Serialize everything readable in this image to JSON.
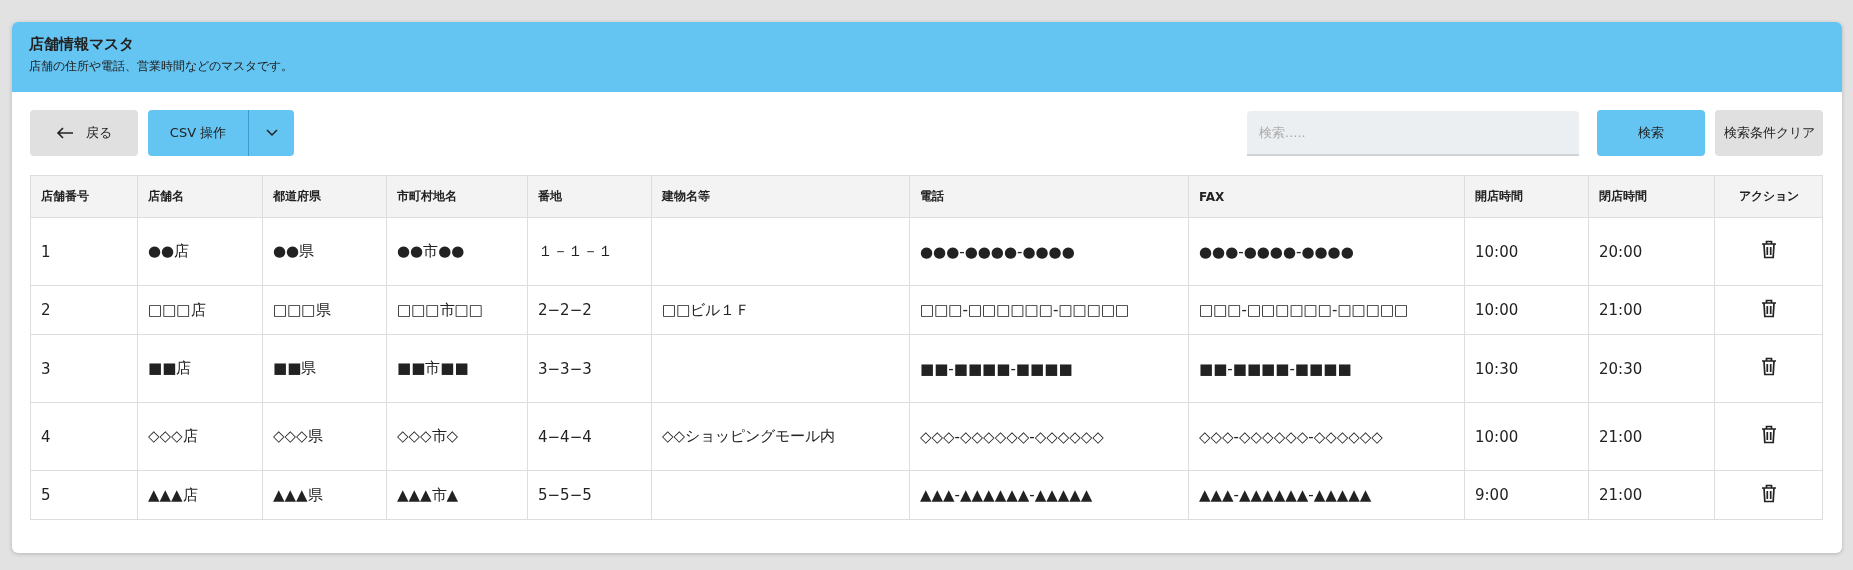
{
  "header": {
    "title": "店舗情報マスタ",
    "subtitle": "店舗の住所や電話、営業時間などのマスタです。"
  },
  "toolbar": {
    "back_button": "戻る",
    "csv_button": "CSV 操作",
    "search": {
      "placeholder": "検索....."
    },
    "search_button": "検索",
    "clear_button": "検索条件クリア"
  },
  "table": {
    "columns": [
      "店舗番号",
      "店舗名",
      "都道府県",
      "市町村地名",
      "番地",
      "建物名等",
      "電話",
      "FAX",
      "開店時間",
      "閉店時間",
      "アクション"
    ],
    "rows": [
      {
        "cells": [
          "1",
          "●●店",
          "●●県",
          "●●市●●",
          "１－１－１",
          "",
          "●●●-●●●●-●●●●",
          "●●●-●●●●-●●●●",
          "10:00",
          "20:00"
        ]
      },
      {
        "cells": [
          "2",
          "□□□店",
          "□□□県",
          "□□□市□□",
          "2−2−2",
          "□□ビル１Ｆ",
          "□□□-□□□□□□-□□□□□",
          "□□□-□□□□□□-□□□□□",
          "10:00",
          "21:00"
        ]
      },
      {
        "cells": [
          "3",
          "■■店",
          "■■県",
          "■■市■■",
          "3−3−3",
          "",
          "■■-■■■■-■■■■",
          "■■-■■■■-■■■■",
          "10:30",
          "20:30"
        ]
      },
      {
        "cells": [
          "4",
          "◇◇◇店",
          "◇◇◇県",
          "◇◇◇市◇",
          "4−4−4",
          "◇◇ショッピングモール内",
          "◇◇◇-◇◇◇◇◇◇-◇◇◇◇◇◇",
          "◇◇◇-◇◇◇◇◇◇-◇◇◇◇◇◇",
          "10:00",
          "21:00"
        ]
      },
      {
        "cells": [
          "5",
          "▲▲▲店",
          "▲▲▲県",
          "▲▲▲市▲",
          "5−5−5",
          "",
          "▲▲▲-▲▲▲▲▲▲-▲▲▲▲▲",
          "▲▲▲-▲▲▲▲▲▲-▲▲▲▲▲",
          "9:00",
          "21:00"
        ]
      }
    ]
  }
}
